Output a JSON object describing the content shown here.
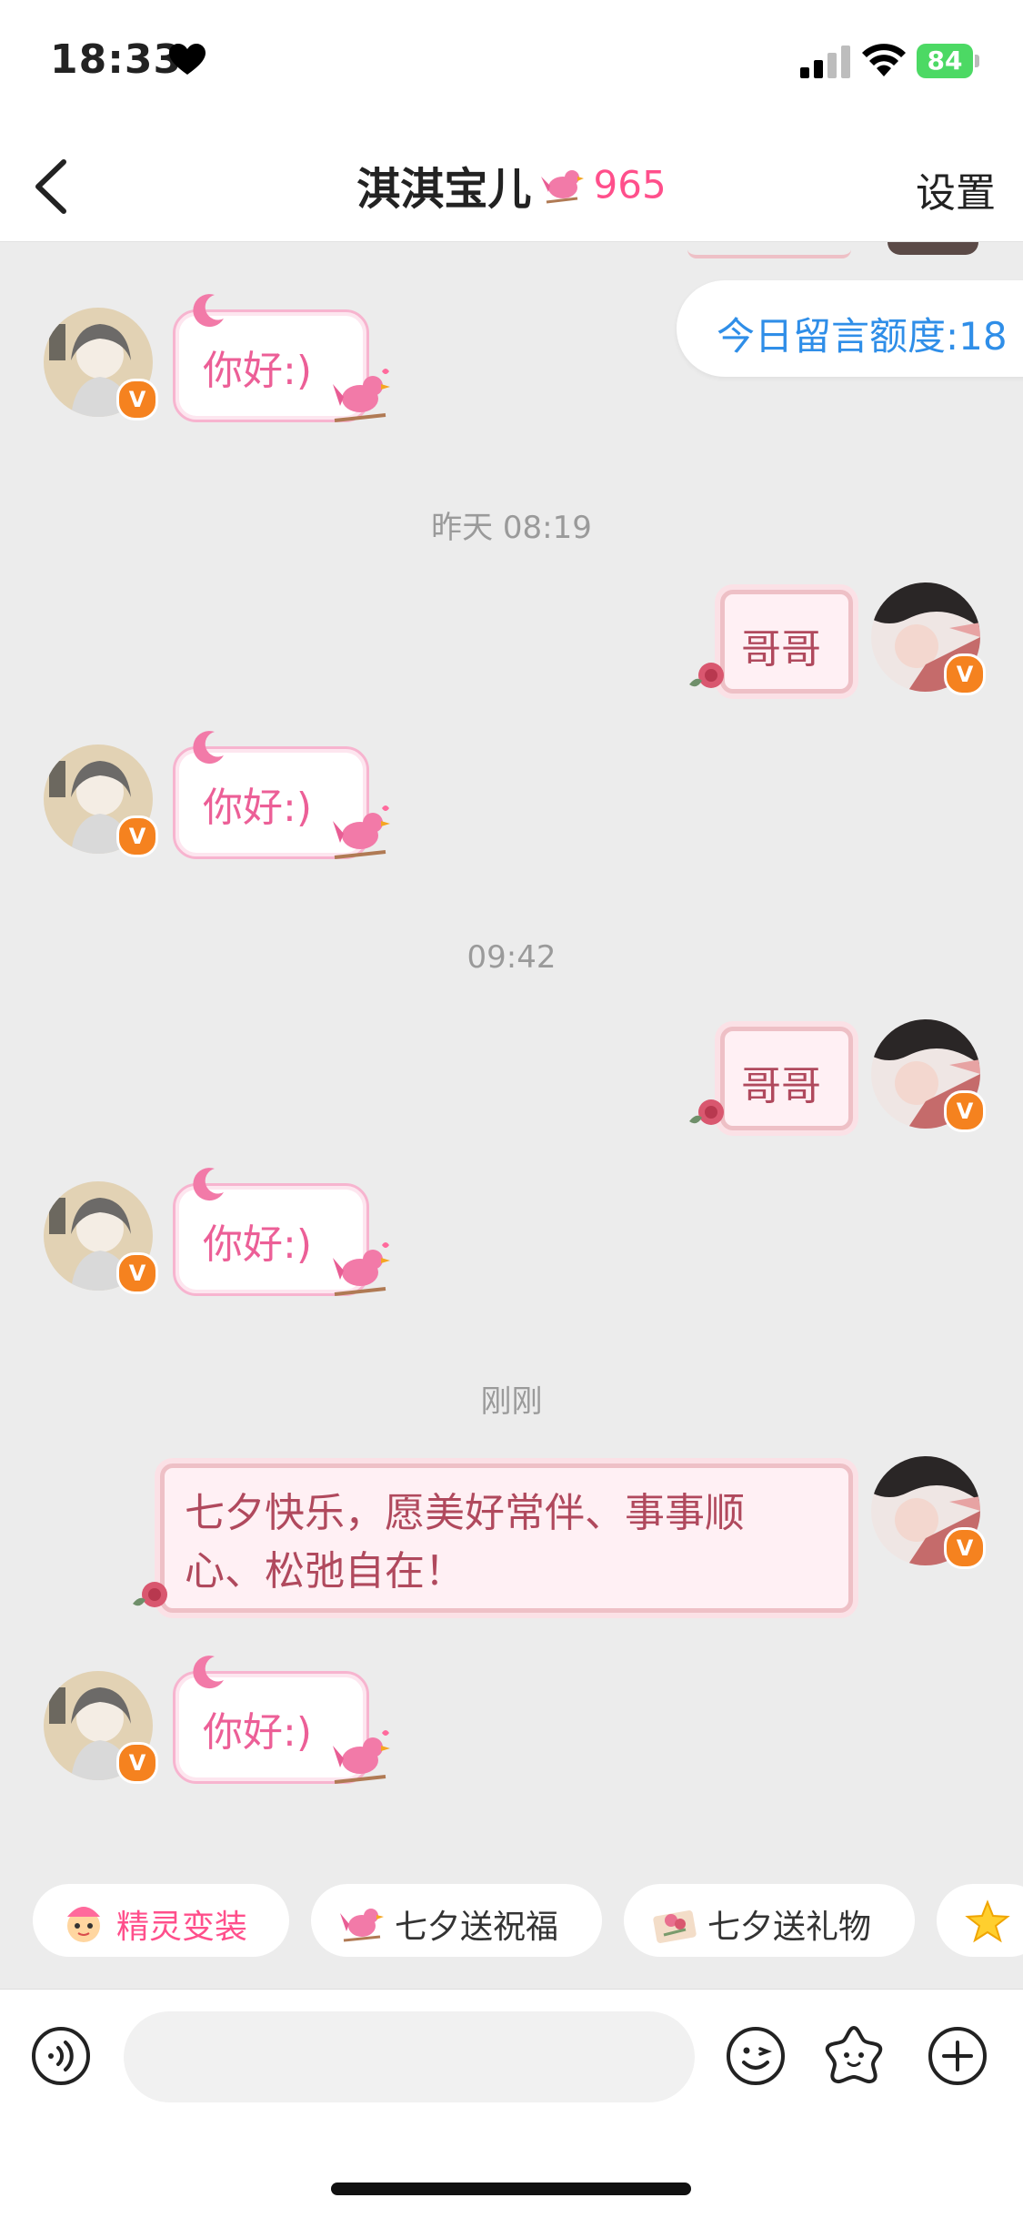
{
  "status_bar": {
    "time": "18:33",
    "battery": "84"
  },
  "header": {
    "title": "淇淇宝儿",
    "count": "965",
    "settings_label": "设置"
  },
  "quota": {
    "text": "今日留言额度:18"
  },
  "messages": {
    "m1": "你好:)",
    "ts1": "昨天 08:19",
    "m2": "哥哥",
    "m3": "你好:)",
    "ts2": "09:42",
    "m4": "哥哥",
    "m5": "你好:)",
    "ts3": "刚刚",
    "m6_line1": "七夕快乐，愿美好常伴、事事顺",
    "m6_line2": "心、松弛自在！",
    "m7": "你好:)"
  },
  "quick_actions": [
    {
      "label": "精灵变装",
      "icon": "sprite-icon",
      "color": "#ff4f8b"
    },
    {
      "label": "七夕送祝福",
      "icon": "bird-icon",
      "color": "#333333"
    },
    {
      "label": "七夕送礼物",
      "icon": "gift-icon",
      "color": "#333333"
    },
    {
      "label": "",
      "icon": "star-icon",
      "color": "#333333"
    }
  ],
  "input": {
    "placeholder": ""
  },
  "colors": {
    "accent": "#ff4f8b",
    "link_blue": "#2f8ee8",
    "badge_orange": "#f5821f"
  }
}
